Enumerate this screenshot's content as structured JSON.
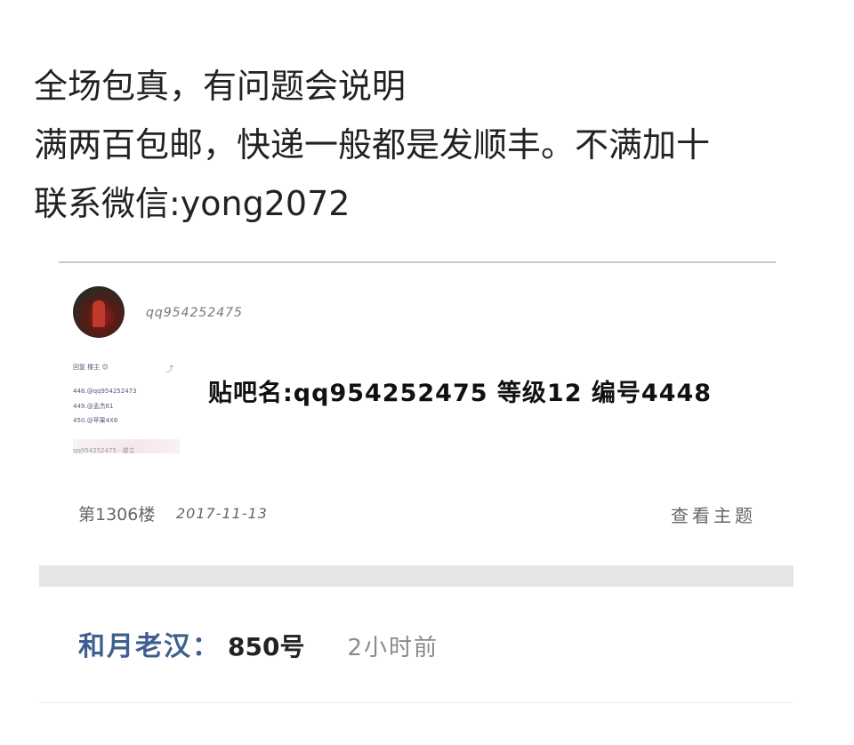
{
  "intro": {
    "line1": "全场包真，有问题会说明",
    "line2": "满两百包邮，快递一般都是发顺丰。不满加十",
    "line3": "联系微信:yong2072"
  },
  "post": {
    "username": "qq954252475",
    "thumb_lines": [
      "回复 楼主 😊",
      "448.@qq954252473",
      "449.@孟杰61",
      "450.@苹果4X6"
    ],
    "thumb_footer": "qq954252475 · 楼主",
    "handwritten_text": "贴吧名:qq954252475 等级12 编号4448",
    "floor": "第1306楼",
    "date": "2017-11-13",
    "view_topic_label": "查看主题"
  },
  "reply": {
    "author": "和月老汉：",
    "text": "850号",
    "time": "2小时前"
  },
  "colors": {
    "reply_author": "#3f5f8f",
    "band": "#e6e6e6"
  },
  "icons": {
    "avatar": "user-avatar-photo",
    "thumb": "screenshot-thumbnail"
  }
}
